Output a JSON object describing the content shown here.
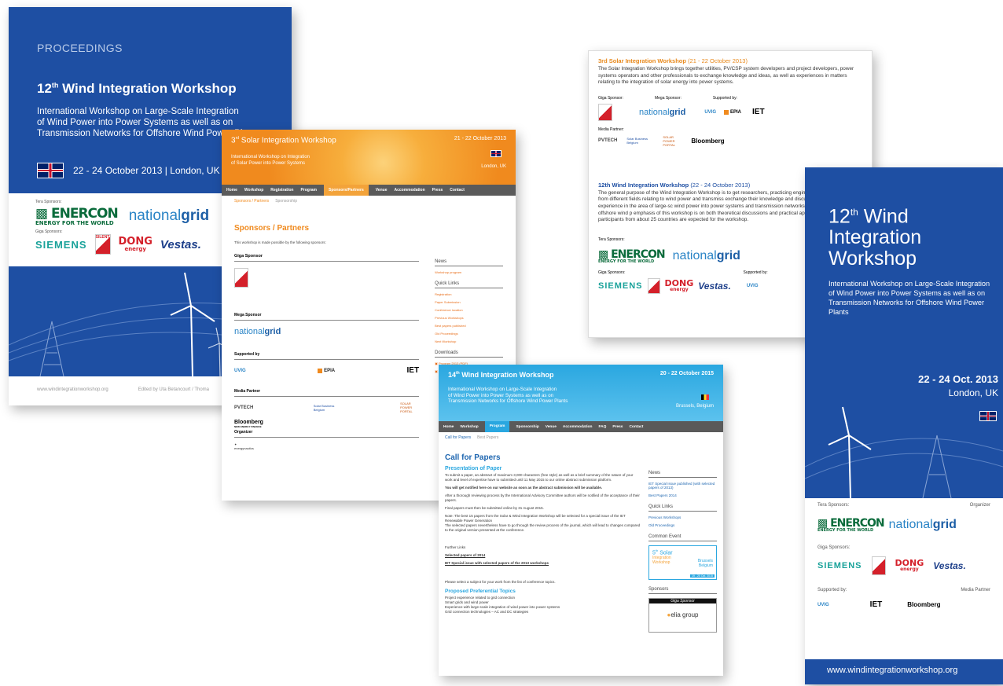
{
  "colors": {
    "wiw_blue": "#1e4fa3",
    "solar_orange": "#f59a2a",
    "sky": "#2aa7e0"
  },
  "p1": {
    "proceedings": "PROCEEDINGS",
    "title": "12",
    "title_sup": "th",
    "title_rest": " Wind Integration Workshop",
    "sub1": "International Workshop on Large-Scale Integration",
    "sub2": "of Wind Power into Power Systems as well as on",
    "sub3": "Transmission Networks for Offshore Wind Power Plants",
    "date": "22 - 24 October 2013 | London, UK",
    "tera": "Tera Sponsors:",
    "giga": "Giga Sponsors:",
    "enercon": "ENERCON",
    "enercon_sub": "ENERGY FOR THE WORLD",
    "ng1": "national",
    "ng2": "grid",
    "siemens": "SIEMENS",
    "silent": "SILENT",
    "dong": "DONG",
    "dong_sub": "energy",
    "vestas": "Vestas.",
    "url": "www.windintegrationworkshop.org",
    "edited": "Edited by Uta Betancourt / Thoma"
  },
  "p2": {
    "title_pre": "3",
    "title_sup": "rd",
    "title": " Solar Integration Workshop",
    "dates": "21 - 22 October 2013",
    "sub1": "International Workshop on Integration",
    "sub2": "of Solar Power into Power Systems",
    "loc": "London, UK",
    "nav": [
      "Home",
      "Workshop",
      "Registration",
      "Program",
      "Sponsors/Partners",
      "Venue",
      "Accommodation",
      "Press",
      "Contact"
    ],
    "sub_nav": [
      "Sponsors / Partners",
      "Sponsorship"
    ],
    "heading": "Sponsors / Partners",
    "intro": "This workshop is made possible by the following sponsors:",
    "giga": "Giga Sponsor",
    "mega": "Mega Sponsor",
    "supported": "Supported by",
    "media": "Media Partner",
    "organizer": "Organizer",
    "uvig": "UVIG",
    "epia": "EPIA",
    "iet": "IET",
    "pvtech": "PVTECH",
    "sbb": "Solar Business Belgium",
    "spp": "SOLAR POWER PORTAL",
    "bloomberg": "Bloomberg",
    "bloomberg_sub": "NEW ENERGY FINANCE",
    "energynautics": "energynautics",
    "news": "News",
    "news_items": [
      "Workshop program"
    ],
    "quick": "Quick Links",
    "quick_items": [
      "Registration",
      "Paper Submission",
      "Conference location",
      "Previous Workshops",
      "Best papers published",
      "Old Proceedings",
      "Next Workshop"
    ],
    "downloads": "Downloads",
    "dl_items": [
      "Program 2013 (PDF)",
      "Selected Papers 2013 (PDF)"
    ]
  },
  "p3": {
    "t1": "3rd Solar Integration Workshop",
    "d1": "(21 - 22 October 2013)",
    "text1": "The Solar Integration Workshop brings together utilities, PV/CSP system developers and project developers, power systems operators and other professionals to exchange knowledge and ideas, as well as experiences in matters relating to the integration of solar energy into power systems.",
    "giga": "Giga Sponsor:",
    "mega": "Mega Sponsor:",
    "supp": "Supported by:",
    "media": "Media Partner:",
    "t2": "12th Wind Integration Workshop",
    "d2": "(22 - 24 October 2013)",
    "text2": "The general purpose of the Wind Integration Workshop is to get researchers, practicing engineers from different fields relating to wind power and transmiss exchange their knowledge and discuss their experience in the area of large-sc wind power into power systems and transmission networks for offshore wind p emphasis of this workshop is on both theoretical discussions and practical app 250 participants from about 25 countries are expected for the workshop.",
    "tera": "Tera Sponsors:",
    "giga2": "Giga Sponsors:",
    "supp2": "Supported by:"
  },
  "p4": {
    "title_pre": "14",
    "title_sup": "th",
    "title": " Wind Integration Workshop",
    "dates": "20 - 22 October 2015",
    "sub1": "International Workshop on Large-Scale Integration",
    "sub2": "of Wind Power into Power Systems as well as on",
    "sub3": "Transmission Networks for Offshore Wind Power Plants",
    "loc": "Brussels, Belgium",
    "nav": [
      "Home",
      "Workshop",
      "Program",
      "Sponsorship",
      "Venue",
      "Accommodation",
      "FAQ",
      "Press",
      "Contact"
    ],
    "sub_nav": [
      "Call for Papers",
      "Best Papers"
    ],
    "heading": "Call for Papers",
    "pres": "Presentation of Paper",
    "para1": "To submit a paper, an abstract of maximum 3,000 characters (free style) as well as a brief summary of the nature of your work and level of expertise have to submitted until 11 May 2015 to our online abstract submission platform.",
    "para2": "You will get notified here on our website as soon as the abstract submission will be available.",
    "para3": "After a thorough reviewing process by the International Advisory Committee authors will be notified of the acceptance of their papers.",
    "para4": "Final papers must then be submitted online by 31 August 2015.",
    "para5": "Note: The best 15 papers from the Solar & Wind Integration Workshop will be selected for a special issue of the IET Renewable Power Generation",
    "para6": "The selected papers nevertheless have to go through the review process of the journal, which will lead to changes compared to the original version presented at the conference.",
    "further": "Further Links",
    "fl1": "Selected papers of 2014",
    "fl2": "IET Special issue with selected papers of the 2013 workshops",
    "select": "Please select a subject for your work from the list of conference topics.",
    "topics_h": "Proposed Preferential Topics",
    "topics": [
      "Project experience related to grid connection",
      "Smart grids and wind power",
      "Experience with large-scale integration of wind power into power systems",
      "Grid connection technologies – AC and DC strategies"
    ],
    "news": "News",
    "news_items": [
      "IET Special Issue published (with selected papers of 2013)",
      "Best Papers 2014"
    ],
    "quick": "Quick Links",
    "quick_items": [
      "Previous Workshops",
      "Old Proceedings"
    ],
    "common": "Common Event",
    "ce_title": "5",
    "ce_sup": "th",
    "ce_rest": " Solar",
    "ce_l2": "Integration",
    "ce_l3": "Workshop",
    "ce_city": "Brussels",
    "ce_country": "Belgium",
    "ce_date": "19 - 20 Oct. 2015",
    "sponsors": "Sponsors",
    "giga": "Giga Sponsor",
    "elia": "elia group"
  },
  "p5": {
    "t1": "12",
    "sup": "th",
    "t2": " Wind",
    "t3": "Integration",
    "t4": "Workshop",
    "sub": "International Workshop on Large-Scale Integration of Wind Power into Power Systems as well as on Transmission Networks for Offshore Wind Power Plants",
    "date": "22 - 24 Oct. 2013",
    "loc": "London, UK",
    "tera": "Tera Sponsors:",
    "organizer": "Organizer",
    "giga": "Giga Sponsors:",
    "supp": "Supported by:",
    "media": "Media Partner",
    "url": "www.windintegrationworkshop.org"
  }
}
